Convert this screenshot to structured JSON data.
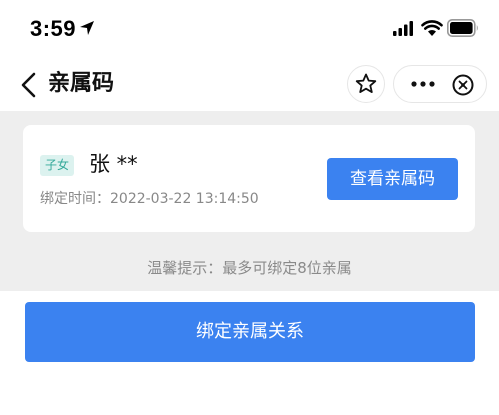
{
  "status_bar": {
    "time": "3:59",
    "icons": [
      "location-arrow-icon",
      "signal-icon",
      "wifi-icon",
      "battery-icon"
    ]
  },
  "nav": {
    "title": "亲属码",
    "icons": [
      "back-icon",
      "star-icon",
      "more-icon",
      "close-icon"
    ]
  },
  "card": {
    "relation_tag": "子女",
    "name": "张 **",
    "bind_time": "绑定时间：2022-03-22 13:14:50",
    "view_button": "查看亲属码"
  },
  "tip": "温馨提示：最多可绑定8位亲属",
  "bind_button": "绑定亲属关系",
  "colors": {
    "primary": "#3b82f0",
    "tag_bg": "#dcf2ef",
    "tag_text": "#34a99a",
    "section_bg": "#eeeeee"
  }
}
